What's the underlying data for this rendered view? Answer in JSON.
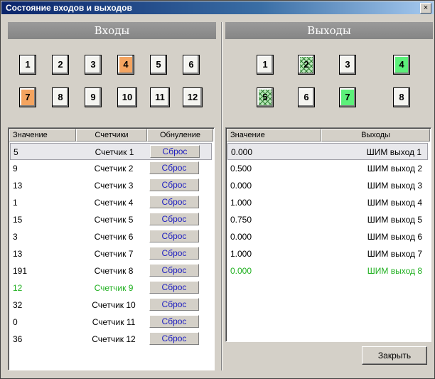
{
  "window": {
    "title": "Состояние входов и выходов",
    "close_glyph": "×"
  },
  "inputs": {
    "header": "Входы",
    "indicators": [
      {
        "label": "1",
        "state": "off"
      },
      {
        "label": "2",
        "state": "off"
      },
      {
        "label": "3",
        "state": "off"
      },
      {
        "label": "4",
        "state": "on"
      },
      {
        "label": "5",
        "state": "off"
      },
      {
        "label": "6",
        "state": "off"
      },
      {
        "label": "7",
        "state": "on"
      },
      {
        "label": "8",
        "state": "off"
      },
      {
        "label": "9",
        "state": "off"
      },
      {
        "label": "10",
        "state": "off"
      },
      {
        "label": "11",
        "state": "off"
      },
      {
        "label": "12",
        "state": "off"
      }
    ],
    "columns": [
      "Значение",
      "Счетчики",
      "Обнуление"
    ],
    "reset_label": "Сброс",
    "rows": [
      {
        "value": "5",
        "name": "Счетчик 1",
        "selected": true,
        "highlight": false
      },
      {
        "value": "9",
        "name": "Счетчик 2",
        "selected": false,
        "highlight": false
      },
      {
        "value": "13",
        "name": "Счетчик 3",
        "selected": false,
        "highlight": false
      },
      {
        "value": "1",
        "name": "Счетчик 4",
        "selected": false,
        "highlight": false
      },
      {
        "value": "15",
        "name": "Счетчик 5",
        "selected": false,
        "highlight": false
      },
      {
        "value": "3",
        "name": "Счетчик 6",
        "selected": false,
        "highlight": false
      },
      {
        "value": "13",
        "name": "Счетчик 7",
        "selected": false,
        "highlight": false
      },
      {
        "value": "191",
        "name": "Счетчик 8",
        "selected": false,
        "highlight": false
      },
      {
        "value": "12",
        "name": "Счетчик 9",
        "selected": false,
        "highlight": true
      },
      {
        "value": "32",
        "name": "Счетчик 10",
        "selected": false,
        "highlight": false
      },
      {
        "value": "0",
        "name": "Счетчик 11",
        "selected": false,
        "highlight": false
      },
      {
        "value": "36",
        "name": "Счетчик 12",
        "selected": false,
        "highlight": false
      }
    ]
  },
  "outputs": {
    "header": "Выходы",
    "indicators": [
      {
        "label": "1",
        "state": "off"
      },
      {
        "label": "2",
        "state": "pwm"
      },
      {
        "label": "3",
        "state": "off"
      },
      {
        "label": "4",
        "state": "on"
      },
      {
        "label": "5",
        "state": "pwm"
      },
      {
        "label": "6",
        "state": "off"
      },
      {
        "label": "7",
        "state": "on"
      },
      {
        "label": "8",
        "state": "off"
      }
    ],
    "columns": [
      "Значение",
      "Выходы"
    ],
    "rows": [
      {
        "value": "0.000",
        "name": "ШИМ выход 1",
        "selected": true,
        "highlight": false
      },
      {
        "value": "0.500",
        "name": "ШИМ выход 2",
        "selected": false,
        "highlight": false
      },
      {
        "value": "0.000",
        "name": "ШИМ выход 3",
        "selected": false,
        "highlight": false
      },
      {
        "value": "1.000",
        "name": "ШИМ выход 4",
        "selected": false,
        "highlight": false
      },
      {
        "value": "0.750",
        "name": "ШИМ выход 5",
        "selected": false,
        "highlight": false
      },
      {
        "value": "0.000",
        "name": "ШИМ выход 6",
        "selected": false,
        "highlight": false
      },
      {
        "value": "1.000",
        "name": "ШИМ выход 7",
        "selected": false,
        "highlight": false
      },
      {
        "value": "0.000",
        "name": "ШИМ выход 8",
        "selected": false,
        "highlight": true
      }
    ]
  },
  "footer": {
    "close_label": "Закрыть"
  },
  "colors": {
    "input_on": "#f4a460",
    "output_on": "#5cf07a",
    "pwm_hatch": "#2e7d32",
    "highlight_text": "#20b020",
    "reset_text": "#2020c0"
  }
}
